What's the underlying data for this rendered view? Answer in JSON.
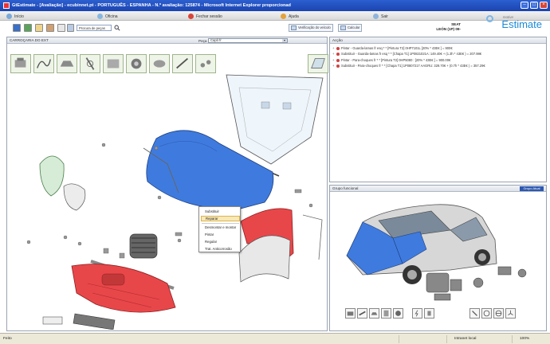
{
  "window": {
    "title": "GtEstimate - [Avaliação] - ecubinnet.pt - PORTUGUÊS - ESPANHA - N.º avaliação: 125874 - Microsoft Internet Explorer proporcionad"
  },
  "menu": {
    "items": [
      {
        "label": "Início",
        "icon_color": "#7aa9da"
      },
      {
        "label": "Oficina",
        "icon_color": "#88b6e0"
      },
      {
        "label": "Fechar sessão",
        "icon_color": "#d8443a"
      },
      {
        "label": "Ajuda",
        "icon_color": "#e4a23a"
      },
      {
        "label": "Sair",
        "icon_color": "#8fb4dc"
      }
    ]
  },
  "brand": {
    "tagline": "motive",
    "name": "Estimate"
  },
  "toolbar": {
    "search_placeholder": "Procura de peças",
    "vehicle_check_label": "Verificação do veículo",
    "calculate_label": "Calcular"
  },
  "vehicle": {
    "make": "SEAT",
    "model": "LEÓN (1P) 09-"
  },
  "left_panel": {
    "title": "CARROÇARIA DO EXT",
    "peca_label": "Peça",
    "peca_value": "Capô fr"
  },
  "context_menu": {
    "items": [
      "Substituir",
      "Reparar",
      "Desmontar e montar",
      "Pintar",
      "Regular",
      "Trat. Anticorrosão"
    ],
    "active": "Reparar"
  },
  "acao_panel": {
    "title": "Acção",
    "rows": [
      {
        "text": "Pintar - Guarda-lamas fr esq * * [Pintura T2] 0HP7101L  [20% * 43E€ ] = 900€",
        "color": "#d04040"
      },
      {
        "text": "Substituir - Guarda-lamas fr esq * * [Chapa T1] 1P0821021A: 149.40€ + (1.3h * 43E€ ) = 207.98€",
        "color": "#d04040"
      },
      {
        "text": "Pintar - Para-choques fr * * [Pintura T2] 0HP5080 : [20% * 43E€ ] = 900.00€",
        "color": "#d04040"
      },
      {
        "text": "Substituir - Para-choques fr * * [Chapa T1] 1P0807217 AAGRU: 329.70€ + (0.7h * 43E€ ) = 357.29€",
        "color": "#d04040"
      }
    ]
  },
  "grupo_panel": {
    "title": "Grupo funcional",
    "button_label": "Grupo Atual"
  },
  "colors": {
    "hood": "#3f7bde",
    "bumper": "#e8474a",
    "fender": "#e8474a",
    "accent": "#1a8ad8"
  },
  "status": {
    "left_text": "Feito",
    "zone_text": "Intranet local",
    "zoom_text": "100%"
  }
}
